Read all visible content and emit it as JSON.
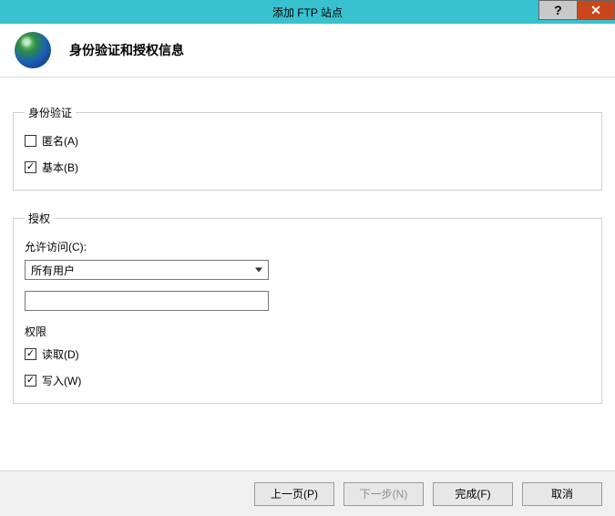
{
  "window": {
    "title": "添加 FTP 站点",
    "help_symbol": "?",
    "close_symbol": "✕"
  },
  "header": {
    "title": "身份验证和授权信息"
  },
  "auth_group": {
    "legend": "身份验证",
    "anonymous": {
      "label": "匿名(A)",
      "checked": false
    },
    "basic": {
      "label": "基本(B)",
      "checked": true
    }
  },
  "authz_group": {
    "legend": "授权",
    "allow_label": "允许访问(C):",
    "allow_selected": "所有用户",
    "specific_value": "",
    "perm_heading": "权限",
    "read": {
      "label": "读取(D)",
      "checked": true
    },
    "write": {
      "label": "写入(W)",
      "checked": true
    }
  },
  "buttons": {
    "prev": "上一页(P)",
    "next": "下一步(N)",
    "finish": "完成(F)",
    "cancel": "取消"
  }
}
